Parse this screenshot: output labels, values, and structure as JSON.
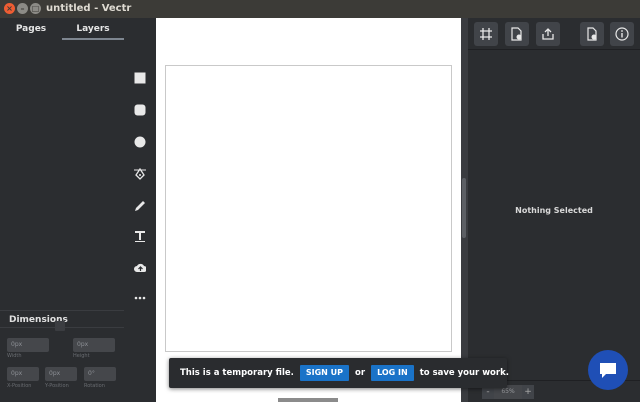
{
  "window": {
    "title": "untitled - Vectr"
  },
  "left_panel": {
    "tabs": [
      {
        "label": "Pages"
      },
      {
        "label": "Layers"
      }
    ],
    "dimensions": {
      "title": "Dimensions",
      "width": {
        "value": "0px",
        "label": "Width"
      },
      "height": {
        "value": "0px",
        "label": "Height"
      },
      "x": {
        "value": "0px",
        "label": "X-Position"
      },
      "y": {
        "value": "0px",
        "label": "Y-Position"
      },
      "rotation": {
        "value": "0°",
        "label": "Rotation"
      }
    }
  },
  "tools": [
    {
      "icon": "rectangle-icon"
    },
    {
      "icon": "rounded-rectangle-icon"
    },
    {
      "icon": "ellipse-icon"
    },
    {
      "icon": "pen-tool-icon"
    },
    {
      "icon": "pencil-icon"
    },
    {
      "icon": "text-tool-icon"
    },
    {
      "icon": "upload-image-icon"
    },
    {
      "icon": "more-icon"
    }
  ],
  "right_panel": {
    "toolbar": [
      "grid-icon",
      "document-settings-icon",
      "export-icon",
      "file-icon",
      "info-icon"
    ],
    "empty_state": "Nothing Selected",
    "zoom": {
      "minus": "-",
      "value": "65%",
      "plus": "+"
    }
  },
  "toast": {
    "text_before": "This is a temporary file.",
    "signup_label": "SIGN UP",
    "or_text": "or",
    "login_label": "LOG IN",
    "text_after": "to save your work."
  },
  "colors": {
    "accent": "#1a73c8",
    "chat": "#1f4fb6",
    "close": "#ef5d33"
  }
}
